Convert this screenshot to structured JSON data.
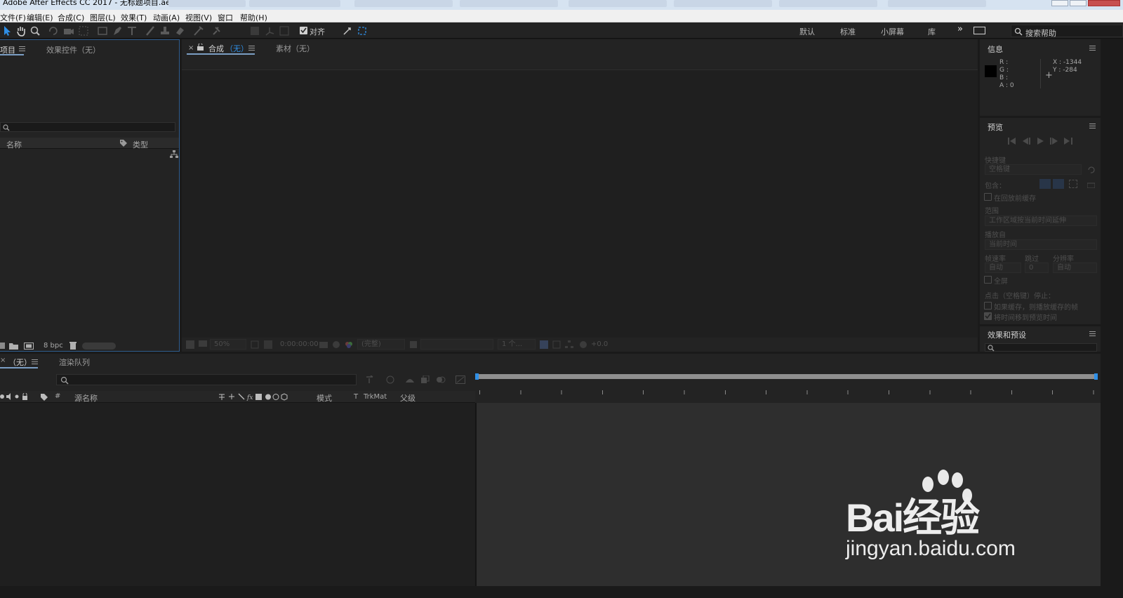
{
  "window": {
    "title": "Adobe After Effects CC 2017 - 无标题项目.aep"
  },
  "menu": [
    "文件(F)",
    "编辑(E)",
    "合成(C)",
    "图层(L)",
    "效果(T)",
    "动画(A)",
    "视图(V)",
    "窗口",
    "帮助(H)"
  ],
  "toolbar": {
    "snap_label": "对齐",
    "workspaces": [
      "默认",
      "标准",
      "小屏幕",
      "库"
    ],
    "more": "»",
    "search_placeholder": "搜索帮助"
  },
  "project_panel": {
    "tab_project": "项目",
    "tab_effects": "效果控件（无）",
    "col_name": "名称",
    "col_type": "类型",
    "bpc": "8 bpc"
  },
  "comp_panel": {
    "tab_comp": "合成",
    "tab_comp_state": "（无）",
    "tab_footage": "素材（无）",
    "zoom": "50%",
    "timecode": "0:00:00:00",
    "resolution": "(完整)",
    "views": "1 个...",
    "exposure": "+0.0"
  },
  "info_panel": {
    "title": "信息",
    "r": "R :",
    "g": "G :",
    "b": "B :",
    "a": "A : 0",
    "x": "X : -1344",
    "y": "Y : -284"
  },
  "preview_panel": {
    "title": "预览",
    "shortcut_label": "快捷键",
    "shortcut_value": "空格键",
    "include_label": "包含：",
    "cache_before": "在回放前缓存",
    "range_label": "范围",
    "range_value": "工作区域按当前时间延伸",
    "play_from_label": "播放自",
    "play_from_value": "当前时间",
    "fps_label": "帧速率",
    "skip_label": "跳过",
    "res_label": "分辨率",
    "fps_value": "自动",
    "skip_value": "0",
    "res_value": "自动",
    "fullscreen": "全屏",
    "on_stop_label": "点击（空格键）停止：",
    "if_cached": "如果缓存，则播放缓存的帧",
    "move_time": "将时间移到预览时间"
  },
  "effects_panel": {
    "title": "效果和预设"
  },
  "timeline": {
    "tab_comp": "（无）",
    "tab_render": "渲染队列",
    "col_num": "#",
    "col_source": "源名称",
    "col_mode": "模式",
    "col_t": "T",
    "col_trkmat": "TrkMat",
    "col_parent": "父级"
  },
  "watermark": {
    "brand": "Bai经验",
    "url": "jingyan.baidu.com"
  },
  "colors": {
    "accent": "#2f8fe6",
    "panel": "#232323",
    "bg": "#1a1a1a"
  }
}
